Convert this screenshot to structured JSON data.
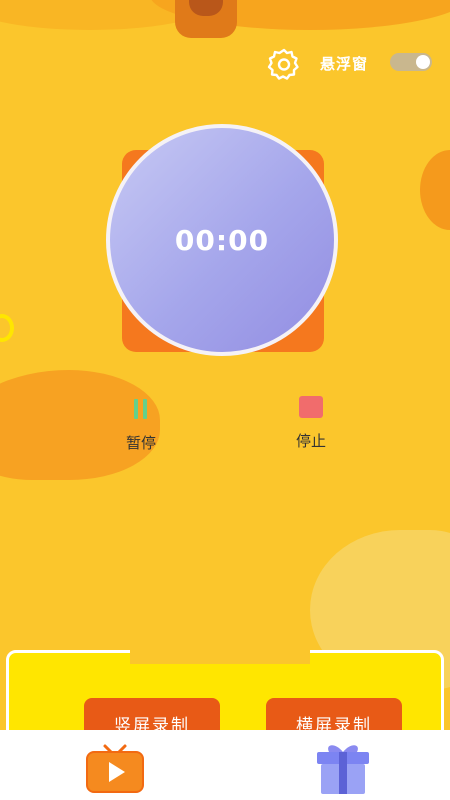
{
  "topbar": {
    "settings_icon": "gear-icon",
    "floating_window_label": "悬浮窗",
    "floating_window_enabled": true
  },
  "timer": {
    "display": "00:00"
  },
  "controls": {
    "pause_label": "暂停",
    "pause_icon": "pause-icon",
    "stop_label": "停止",
    "stop_icon": "stop-icon"
  },
  "record": {
    "portrait_label": "竖屏录制",
    "landscape_label": "横屏录制"
  },
  "tabs": [
    {
      "icon": "tv-play-icon"
    },
    {
      "icon": "gift-icon"
    }
  ],
  "colors": {
    "background": "#FBC62C",
    "accent_orange": "#F5781E",
    "record_button": "#E85A16",
    "panel": "#FFE600",
    "timer_circle": "#A5A6EB",
    "stop": "#F16C6C",
    "pause": "#64D08A"
  }
}
